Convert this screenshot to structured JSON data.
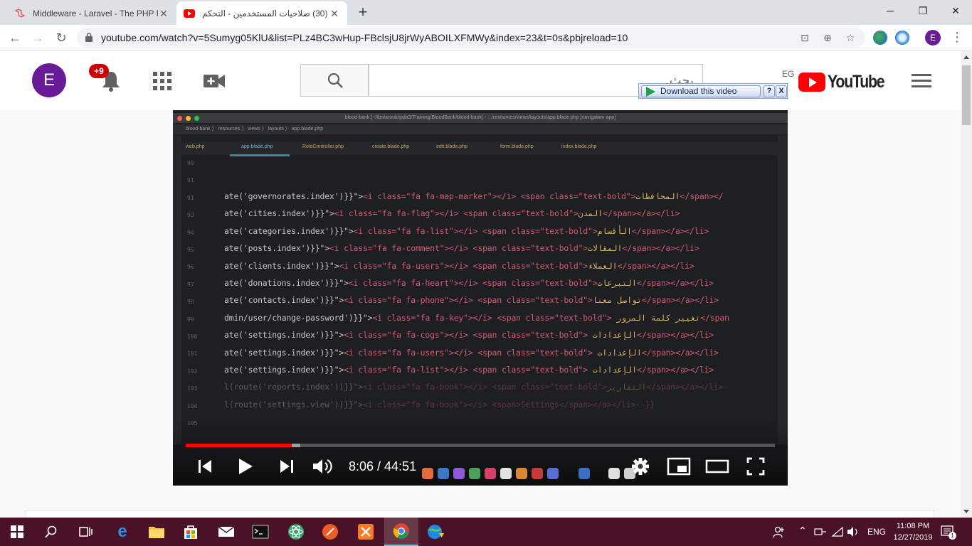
{
  "browser": {
    "tabs": [
      {
        "title": "Middleware - Laravel - The PHP F",
        "favicon": "laravel-icon"
      },
      {
        "title": "(30) صلاحيات المستخدمين - التحكم",
        "favicon": "youtube-icon"
      }
    ],
    "new_tab": "+",
    "window": {
      "minimize": "─",
      "maximize": "❐",
      "close": "✕"
    },
    "url": "youtube.com/watch?v=5Sumyg05KlU&list=PLz4BC3wHup-FBclsjU8jrWyABOILXFMWy&index=23&t=0s&pbjreload=10",
    "profile_initial": "E"
  },
  "youtube": {
    "avatar_initial": "E",
    "notification_count": "+9",
    "search_placeholder": "بحث",
    "country_code": "EG",
    "logo_text": "YouTube",
    "download_bar": {
      "label": "Download this video",
      "help": "?",
      "close": "X"
    }
  },
  "ide": {
    "title": "blood-bank [~/Ibnfarouk/ipda3/Training/BloodBank/blood-bank] - .../resources/views/layouts/app.blade.php [navigation-app]",
    "path": "blood-bank 〉 resources 〉 views 〉 layouts 〉 app.blade.php",
    "tabs": [
      "web.php",
      "app.blade.php",
      "RoleController.php",
      "create.blade.php",
      "edit.blade.php",
      "form.blade.php",
      "index.blade.php"
    ],
    "line_numbers": [
      "90",
      "91",
      "91",
      "93",
      "94",
      "95",
      "96",
      "97",
      "98",
      "99",
      "100",
      "101",
      "102",
      "103",
      "104",
      "105"
    ],
    "code_lines": [
      {
        "pre": "ate('governorates.index')}}\">",
        "tag": "<i class=\"fa fa-map-marker\"></i> <span class=\"text-bold\">",
        "ar": "المحافظات",
        "post": "</span></"
      },
      {
        "pre": "ate('cities.index')}}\">",
        "tag": "<i class=\"fa fa-flag\"></i> <span class=\"text-bold\">",
        "ar": "المدن",
        "post": "</span></a></li>"
      },
      {
        "pre": "ate('categories.index')}}\">",
        "tag": "<i class=\"fa fa-list\"></i> <span class=\"text-bold\">",
        "ar": "الأقسام",
        "post": "</span></a></li>"
      },
      {
        "pre": "ate('posts.index')}}\">",
        "tag": "<i class=\"fa fa-comment\"></i> <span class=\"text-bold\">",
        "ar": "المقالات",
        "post": "</span></a></li>"
      },
      {
        "pre": "ate('clients.index')}}\">",
        "tag": "<i class=\"fa fa-users\"></i> <span class=\"text-bold\">",
        "ar": "العملاء",
        "post": "</span></a></li>"
      },
      {
        "pre": "ate('donations.index')}}\">",
        "tag": "<i class=\"fa fa-heart\"></i> <span class=\"text-bold\">",
        "ar": "التبرعات",
        "post": "</span></a></li>"
      },
      {
        "pre": "ate('contacts.index')}}\">",
        "tag": "<i class=\"fa fa-phone\"></i> <span class=\"text-bold\">",
        "ar": "تواصل معنا",
        "post": "</span></a></li>"
      },
      {
        "pre": "dmin/user/change-password')}}\">",
        "tag": "<i class=\"fa fa-key\"></i> <span class=\"text-bold\">",
        "ar": " تغيير كلمة المرور",
        "post": "</span"
      },
      {
        "pre": "ate('settings.index')}}\">",
        "tag": "<i class=\"fa fa-cogs\"></i> <span class=\"text-bold\">",
        "ar": " الإعدادات",
        "post": "</span></a></li>"
      },
      {
        "pre": "ate('settings.index')}}\">",
        "tag": "<i class=\"fa fa-users\"></i> <span class=\"text-bold\">",
        "ar": " الإعدادات",
        "post": "</span></a></li>"
      },
      {
        "pre": "ate('settings.index')}}\">",
        "tag": "<i class=\"fa fa-list\"></i> <span class=\"text-bold\">",
        "ar": " الإعدادات",
        "post": "</span></a></li>"
      },
      {
        "pre": "l(route('reports.index'))}}\">",
        "tag": "<i class=\"fa fa-book\"></i> <span class=\"text-bold\">",
        "ar": "التقارير",
        "post": "</span></a></li>-"
      },
      {
        "pre": "l(route('settings.view'))}}\">",
        "tag": "<i class=\"fa fa-book\"></i> <span>Settings</span></a></li>--}}",
        "ar": "",
        "post": ""
      }
    ]
  },
  "player": {
    "time": "8:06 / 44:51",
    "progress_played": 0.18,
    "progress_loaded": 0.195
  },
  "taskbar": {
    "language": "ENG",
    "time": "11:08 PM",
    "date": "12/27/2019",
    "notification_count": "1",
    "colors": {
      "bg": "#4a1226"
    }
  }
}
